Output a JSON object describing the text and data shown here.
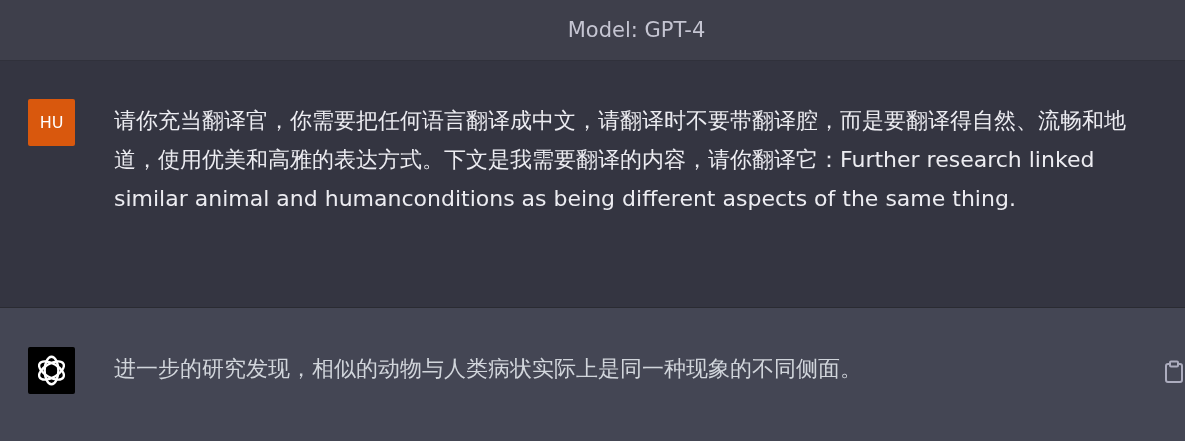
{
  "header": {
    "title": "Model: GPT-4"
  },
  "messages": [
    {
      "kind": "user",
      "avatar": "HU",
      "text": "请你充当翻译官，你需要把任何语言翻译成中文，请翻译时不要带翻译腔，而是要翻译得自然、流畅和地道，使用优美和高雅的表达方式。下文是我需要翻译的内容，请你翻译它：Further research linked similar animal and humanconditions as being different aspects of the same thing."
    },
    {
      "kind": "assistant",
      "text": "进一步的研究发现，相似的动物与人类病状实际上是同一种现象的不同侧面。"
    }
  ]
}
